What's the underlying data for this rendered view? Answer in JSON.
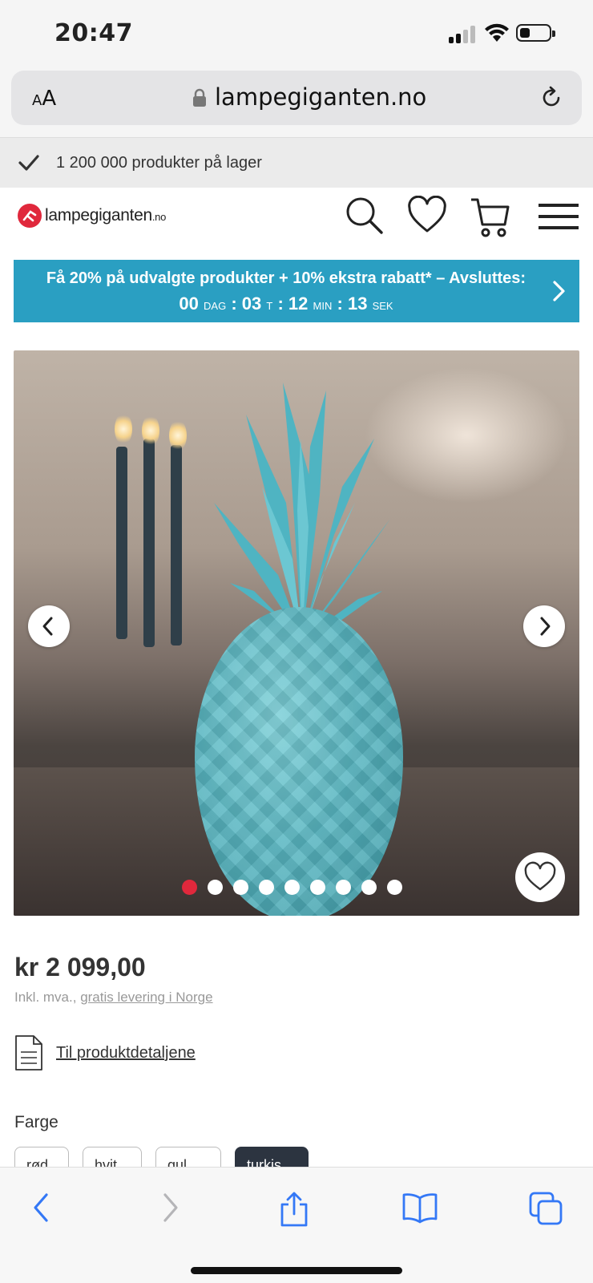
{
  "status": {
    "time": "20:47"
  },
  "browser": {
    "aa_label": "AA",
    "url": "lampegiganten.no"
  },
  "stock": {
    "text": "1 200 000 produkter på lager"
  },
  "logo": {
    "text": "lampegiganten",
    "suffix": ".no"
  },
  "promo": {
    "text": "Få 20% på udvalgte produkter + 10% ekstra rabatt* – Avsluttes:",
    "days": "00",
    "days_unit": "DAG",
    "hours": "03",
    "hours_unit": "T",
    "minutes": "12",
    "minutes_unit": "MIN",
    "seconds": "13",
    "seconds_unit": "SEK",
    "separator": ":"
  },
  "gallery": {
    "image_count": 9,
    "active_index": 0
  },
  "product": {
    "price": "kr 2 099,00",
    "vat_prefix": "Inkl. mva., ",
    "vat_link": "gratis levering i Norge",
    "details_link": "Til produktdetaljene",
    "color_label": "Farge",
    "color_options": [
      "rød",
      "hvit",
      "gul",
      "turkis"
    ],
    "selected_color_index": 3
  },
  "colors": {
    "brand_red": "#e0283c",
    "promo_blue": "#2a9fc2",
    "selected_swatch": "#2c3440",
    "ios_blue": "#3478f6"
  }
}
